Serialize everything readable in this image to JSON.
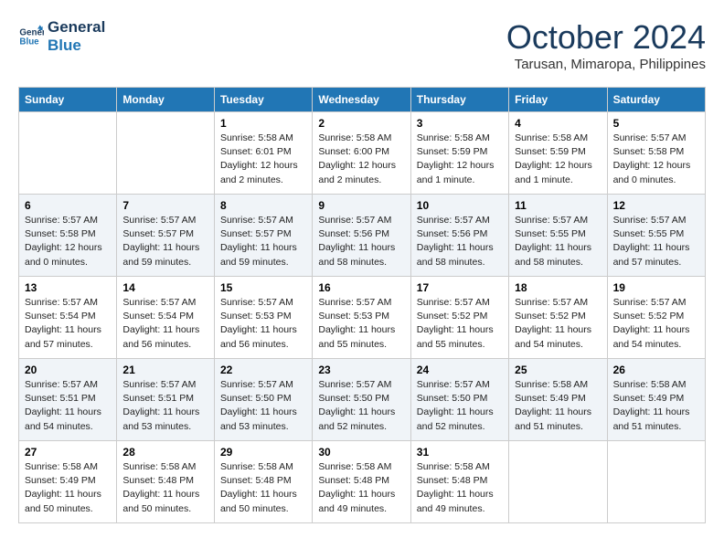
{
  "header": {
    "logo_line1": "General",
    "logo_line2": "Blue",
    "month": "October 2024",
    "location": "Tarusan, Mimaropa, Philippines"
  },
  "weekdays": [
    "Sunday",
    "Monday",
    "Tuesday",
    "Wednesday",
    "Thursday",
    "Friday",
    "Saturday"
  ],
  "weeks": [
    [
      {
        "day": "",
        "info": ""
      },
      {
        "day": "",
        "info": ""
      },
      {
        "day": "1",
        "info": "Sunrise: 5:58 AM\nSunset: 6:01 PM\nDaylight: 12 hours\nand 2 minutes."
      },
      {
        "day": "2",
        "info": "Sunrise: 5:58 AM\nSunset: 6:00 PM\nDaylight: 12 hours\nand 2 minutes."
      },
      {
        "day": "3",
        "info": "Sunrise: 5:58 AM\nSunset: 5:59 PM\nDaylight: 12 hours\nand 1 minute."
      },
      {
        "day": "4",
        "info": "Sunrise: 5:58 AM\nSunset: 5:59 PM\nDaylight: 12 hours\nand 1 minute."
      },
      {
        "day": "5",
        "info": "Sunrise: 5:57 AM\nSunset: 5:58 PM\nDaylight: 12 hours\nand 0 minutes."
      }
    ],
    [
      {
        "day": "6",
        "info": "Sunrise: 5:57 AM\nSunset: 5:58 PM\nDaylight: 12 hours\nand 0 minutes."
      },
      {
        "day": "7",
        "info": "Sunrise: 5:57 AM\nSunset: 5:57 PM\nDaylight: 11 hours\nand 59 minutes."
      },
      {
        "day": "8",
        "info": "Sunrise: 5:57 AM\nSunset: 5:57 PM\nDaylight: 11 hours\nand 59 minutes."
      },
      {
        "day": "9",
        "info": "Sunrise: 5:57 AM\nSunset: 5:56 PM\nDaylight: 11 hours\nand 58 minutes."
      },
      {
        "day": "10",
        "info": "Sunrise: 5:57 AM\nSunset: 5:56 PM\nDaylight: 11 hours\nand 58 minutes."
      },
      {
        "day": "11",
        "info": "Sunrise: 5:57 AM\nSunset: 5:55 PM\nDaylight: 11 hours\nand 58 minutes."
      },
      {
        "day": "12",
        "info": "Sunrise: 5:57 AM\nSunset: 5:55 PM\nDaylight: 11 hours\nand 57 minutes."
      }
    ],
    [
      {
        "day": "13",
        "info": "Sunrise: 5:57 AM\nSunset: 5:54 PM\nDaylight: 11 hours\nand 57 minutes."
      },
      {
        "day": "14",
        "info": "Sunrise: 5:57 AM\nSunset: 5:54 PM\nDaylight: 11 hours\nand 56 minutes."
      },
      {
        "day": "15",
        "info": "Sunrise: 5:57 AM\nSunset: 5:53 PM\nDaylight: 11 hours\nand 56 minutes."
      },
      {
        "day": "16",
        "info": "Sunrise: 5:57 AM\nSunset: 5:53 PM\nDaylight: 11 hours\nand 55 minutes."
      },
      {
        "day": "17",
        "info": "Sunrise: 5:57 AM\nSunset: 5:52 PM\nDaylight: 11 hours\nand 55 minutes."
      },
      {
        "day": "18",
        "info": "Sunrise: 5:57 AM\nSunset: 5:52 PM\nDaylight: 11 hours\nand 54 minutes."
      },
      {
        "day": "19",
        "info": "Sunrise: 5:57 AM\nSunset: 5:52 PM\nDaylight: 11 hours\nand 54 minutes."
      }
    ],
    [
      {
        "day": "20",
        "info": "Sunrise: 5:57 AM\nSunset: 5:51 PM\nDaylight: 11 hours\nand 54 minutes."
      },
      {
        "day": "21",
        "info": "Sunrise: 5:57 AM\nSunset: 5:51 PM\nDaylight: 11 hours\nand 53 minutes."
      },
      {
        "day": "22",
        "info": "Sunrise: 5:57 AM\nSunset: 5:50 PM\nDaylight: 11 hours\nand 53 minutes."
      },
      {
        "day": "23",
        "info": "Sunrise: 5:57 AM\nSunset: 5:50 PM\nDaylight: 11 hours\nand 52 minutes."
      },
      {
        "day": "24",
        "info": "Sunrise: 5:57 AM\nSunset: 5:50 PM\nDaylight: 11 hours\nand 52 minutes."
      },
      {
        "day": "25",
        "info": "Sunrise: 5:58 AM\nSunset: 5:49 PM\nDaylight: 11 hours\nand 51 minutes."
      },
      {
        "day": "26",
        "info": "Sunrise: 5:58 AM\nSunset: 5:49 PM\nDaylight: 11 hours\nand 51 minutes."
      }
    ],
    [
      {
        "day": "27",
        "info": "Sunrise: 5:58 AM\nSunset: 5:49 PM\nDaylight: 11 hours\nand 50 minutes."
      },
      {
        "day": "28",
        "info": "Sunrise: 5:58 AM\nSunset: 5:48 PM\nDaylight: 11 hours\nand 50 minutes."
      },
      {
        "day": "29",
        "info": "Sunrise: 5:58 AM\nSunset: 5:48 PM\nDaylight: 11 hours\nand 50 minutes."
      },
      {
        "day": "30",
        "info": "Sunrise: 5:58 AM\nSunset: 5:48 PM\nDaylight: 11 hours\nand 49 minutes."
      },
      {
        "day": "31",
        "info": "Sunrise: 5:58 AM\nSunset: 5:48 PM\nDaylight: 11 hours\nand 49 minutes."
      },
      {
        "day": "",
        "info": ""
      },
      {
        "day": "",
        "info": ""
      }
    ]
  ]
}
